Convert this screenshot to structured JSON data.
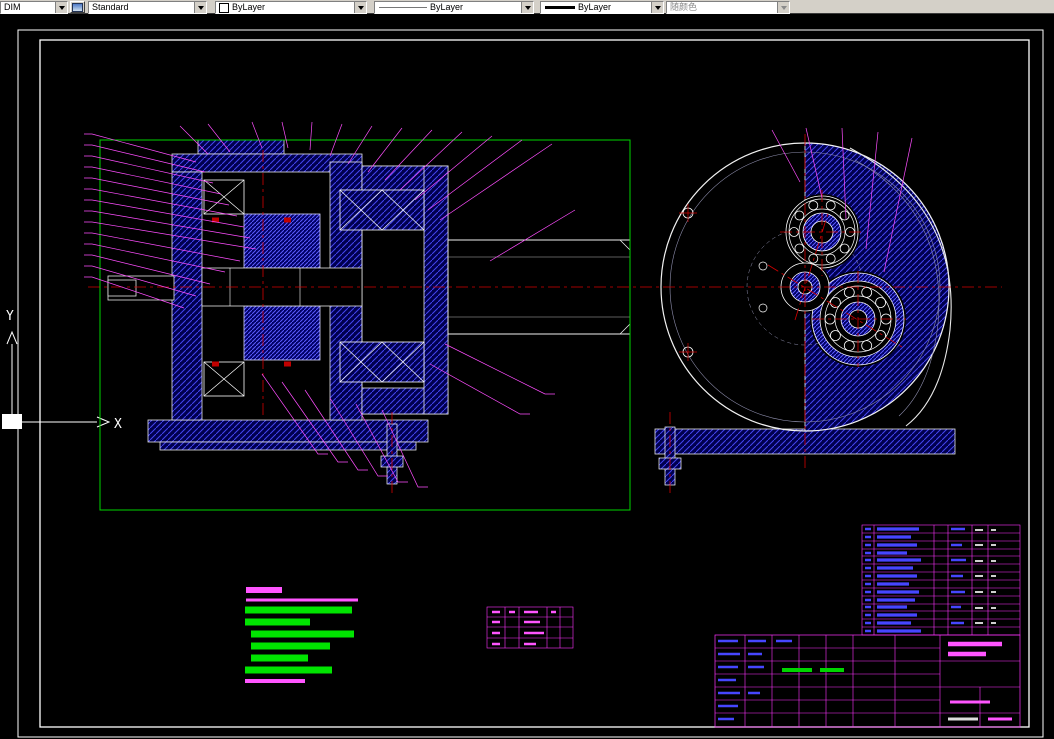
{
  "toolbar": {
    "dim_style": {
      "value": "DIM"
    },
    "text_style": {
      "value": "Standard"
    },
    "color_control": {
      "value": "ByLayer",
      "swatch": "#ffffff"
    },
    "linetype_control": {
      "value": "ByLayer"
    },
    "lineweight_control": {
      "value": "ByLayer"
    },
    "plot_style_control": {
      "value": "随颜色",
      "enabled": false
    }
  },
  "ucs": {
    "x_label": "X",
    "y_label": "Y"
  },
  "colors": {
    "canvas_bg": "#000000",
    "toolbar_bg": "#d4d0c8",
    "frame": "#ffffff",
    "section_hatch": "#4545f0",
    "section_fill": "#00004f",
    "centerline": "#d40000",
    "leader": "#ff4dff",
    "notes_green": "#00e400",
    "table_grid": "#ff33ff",
    "table_text_blue": "#4646ff"
  }
}
